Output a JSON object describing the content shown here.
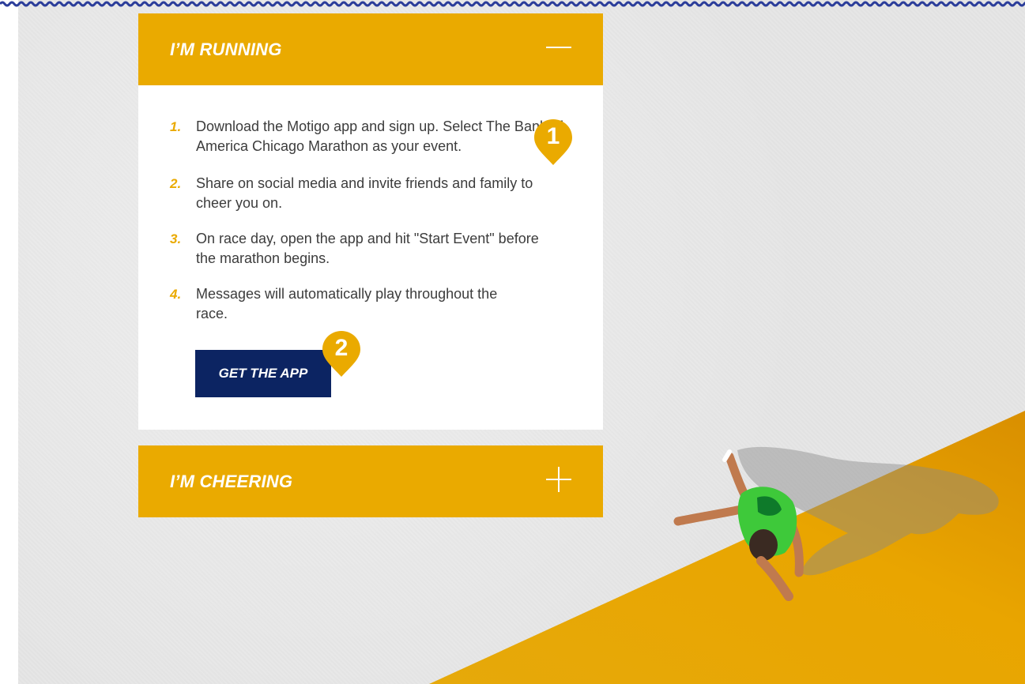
{
  "colors": {
    "accent_yellow": "#eaaa00",
    "navy": "#0c2462",
    "wave_blue": "#2b3d9a",
    "text_gray": "#3c3c3c",
    "background_gray": "#e6e6e6"
  },
  "running": {
    "title": "I’M RUNNING",
    "toggle_icon": "minus-icon",
    "steps": [
      {
        "num": "1.",
        "text": "Download the Motigo app and sign up. Select The Bank of America Chicago Marathon as your event."
      },
      {
        "num": "2.",
        "text": "Share on social media and invite friends and family to cheer you on."
      },
      {
        "num": "3.",
        "text": "On race day, open the app and hit \"Start Event\" before the marathon begins."
      },
      {
        "num": "4.",
        "text": "Messages will automatically play throughout the race."
      }
    ],
    "cta_label": "GET THE APP"
  },
  "cheering": {
    "title": "I’M CHEERING",
    "toggle_icon": "plus-icon"
  },
  "markers": [
    {
      "label": "1",
      "icon": "map-pin-icon"
    },
    {
      "label": "2",
      "icon": "map-pin-icon"
    }
  ]
}
